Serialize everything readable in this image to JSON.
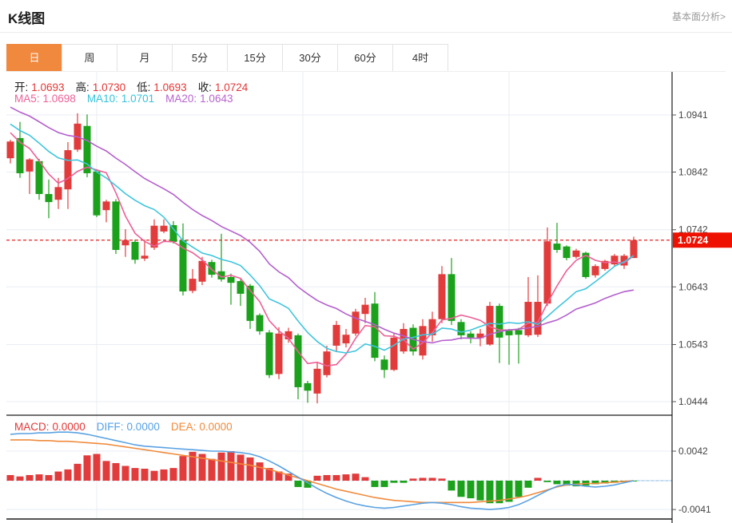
{
  "header": {
    "title": "K线图",
    "link": "基本面分析>"
  },
  "tabs": {
    "items": [
      "日",
      "周",
      "月",
      "5分",
      "15分",
      "30分",
      "60分",
      "4时"
    ],
    "active_index": 0
  },
  "ohlc": {
    "open_label": "开:",
    "open": "1.0693",
    "high_label": "高:",
    "high": "1.0730",
    "low_label": "低:",
    "low": "1.0693",
    "close_label": "收:",
    "close": "1.0724"
  },
  "ma_legend": {
    "ma5_label": "MA5:",
    "ma5": "1.0698",
    "ma10_label": "MA10:",
    "ma10": "1.0701",
    "ma20_label": "MA20:",
    "ma20": "1.0643"
  },
  "macd_legend": {
    "macd_label": "MACD:",
    "macd": "0.0000",
    "diff_label": "DIFF:",
    "diff": "0.0000",
    "dea_label": "DEA:",
    "dea": "0.0000"
  },
  "colors": {
    "up": "#e23b3b",
    "down": "#1ba11b",
    "ma5": "#ed5f96",
    "ma10": "#3fc5dd",
    "ma20": "#b45fcd",
    "diff": "#5aa2e2",
    "dea": "#f08a3c",
    "badge": "#ee1100",
    "price_line": "#e62222",
    "grid": "#e8edf4",
    "vgrid": "#e9ecf1",
    "zero_line": "#b9d2e8",
    "axis": "#1a1a1a",
    "axis_text": "#444444",
    "tab_active": "#f0883e"
  },
  "chart_data": {
    "type": "candlestick+macd",
    "title": "K线图",
    "legend_position": "top-left",
    "grid": true,
    "price_axis": {
      "ticks": [
        "1.0941",
        "1.0842",
        "1.0742",
        "1.0643",
        "1.0543",
        "1.0444"
      ],
      "current": "1.0724",
      "range": [
        1.043,
        1.1015
      ]
    },
    "macd_axis": {
      "ticks": [
        "0.0042",
        "-0.0041"
      ],
      "zero": 0.0
    },
    "candle_format": "[open, high, low, close]",
    "prehistory_closes": [
      1.101,
      1.1004,
      1.0998,
      1.0993,
      1.0987,
      1.0981,
      1.0975,
      1.0969,
      1.0963,
      1.0958,
      1.0952,
      1.0946,
      1.094,
      1.0934,
      1.0929,
      1.0923,
      1.0917,
      1.0911,
      1.0905
    ],
    "candles": [
      [
        1.0866,
        1.0898,
        1.0857,
        1.0895
      ],
      [
        1.0901,
        1.0929,
        1.0832,
        1.084
      ],
      [
        1.0843,
        1.0866,
        1.0804,
        1.0864
      ],
      [
        1.0861,
        1.0865,
        1.0794,
        1.0804
      ],
      [
        1.0804,
        1.0829,
        1.0762,
        1.079
      ],
      [
        1.0794,
        1.0832,
        1.0778,
        1.0816
      ],
      [
        1.0812,
        1.0894,
        1.0778,
        1.088
      ],
      [
        1.0881,
        1.0944,
        1.0877,
        1.0926
      ],
      [
        1.0922,
        1.0942,
        1.0833,
        1.084
      ],
      [
        1.0843,
        1.0845,
        1.0764,
        1.0767
      ],
      [
        1.0776,
        1.0794,
        1.0755,
        1.0791
      ],
      [
        1.0791,
        1.0795,
        1.07,
        1.0707
      ],
      [
        1.0715,
        1.0743,
        1.0695,
        1.0724
      ],
      [
        1.0721,
        1.0725,
        1.0683,
        1.069
      ],
      [
        1.0692,
        1.0725,
        1.0688,
        1.0697
      ],
      [
        1.0711,
        1.076,
        1.0707,
        1.0749
      ],
      [
        1.0739,
        1.076,
        1.0736,
        1.0749
      ],
      [
        1.075,
        1.0757,
        1.0718,
        1.0721
      ],
      [
        1.0724,
        1.0753,
        1.0628,
        1.0635
      ],
      [
        1.0636,
        1.0674,
        1.0632,
        1.0657
      ],
      [
        1.0652,
        1.0695,
        1.0646,
        1.0688
      ],
      [
        1.0686,
        1.069,
        1.0659,
        1.0664
      ],
      [
        1.067,
        1.0735,
        1.0652,
        1.0656
      ],
      [
        1.066,
        1.0666,
        1.0612,
        1.065
      ],
      [
        1.0653,
        1.0656,
        1.061,
        1.0631
      ],
      [
        1.0645,
        1.0648,
        1.057,
        1.0584
      ],
      [
        1.0594,
        1.0597,
        1.056,
        1.0566
      ],
      [
        1.0564,
        1.0568,
        1.0485,
        1.049
      ],
      [
        1.0492,
        1.0573,
        1.0483,
        1.0562
      ],
      [
        1.0552,
        1.0572,
        1.0546,
        1.0566
      ],
      [
        1.0559,
        1.0562,
        1.0448,
        1.0469
      ],
      [
        1.0476,
        1.048,
        1.0442,
        1.0463
      ],
      [
        1.0458,
        1.0512,
        1.0441,
        1.0501
      ],
      [
        1.049,
        1.0541,
        1.0486,
        1.0531
      ],
      [
        1.0541,
        1.0584,
        1.0531,
        1.0577
      ],
      [
        1.0545,
        1.057,
        1.0538,
        1.056
      ],
      [
        1.0562,
        1.0605,
        1.0558,
        1.06
      ],
      [
        1.0596,
        1.0624,
        1.058,
        1.0612
      ],
      [
        1.0614,
        1.0634,
        1.0514,
        1.052
      ],
      [
        1.0517,
        1.0524,
        1.0485,
        1.0499
      ],
      [
        1.0499,
        1.0562,
        1.0497,
        1.0555
      ],
      [
        1.0531,
        1.058,
        1.0527,
        1.057
      ],
      [
        1.0572,
        1.0578,
        1.0524,
        1.0531
      ],
      [
        1.0524,
        1.0587,
        1.0517,
        1.0575
      ],
      [
        1.0559,
        1.06,
        1.0548,
        1.0587
      ],
      [
        1.0587,
        1.0679,
        1.058,
        1.0665
      ],
      [
        1.0665,
        1.0693,
        1.0577,
        1.0584
      ],
      [
        1.0582,
        1.0587,
        1.0552,
        1.0559
      ],
      [
        1.0562,
        1.0566,
        1.0545,
        1.0555
      ],
      [
        1.0554,
        1.057,
        1.054,
        1.0562
      ],
      [
        1.0543,
        1.0617,
        1.0541,
        1.061
      ],
      [
        1.061,
        1.0614,
        1.0511,
        1.0555
      ],
      [
        1.0567,
        1.057,
        1.0508,
        1.0559
      ],
      [
        1.0568,
        1.0572,
        1.051,
        1.056
      ],
      [
        1.0559,
        1.066,
        1.0556,
        1.0617
      ],
      [
        1.056,
        1.0663,
        1.0556,
        1.0617
      ],
      [
        1.0614,
        1.0746,
        1.061,
        1.0722
      ],
      [
        1.0718,
        1.0754,
        1.0702,
        1.0707
      ],
      [
        1.0713,
        1.0715,
        1.0689,
        1.0693
      ],
      [
        1.0695,
        1.0709,
        1.0692,
        1.0706
      ],
      [
        1.0702,
        1.0704,
        1.0657,
        1.066
      ],
      [
        1.0663,
        1.0682,
        1.0659,
        1.0679
      ],
      [
        1.0674,
        1.069,
        1.0671,
        1.0688
      ],
      [
        1.0682,
        1.07,
        1.0678,
        1.0697
      ],
      [
        1.068,
        1.07,
        1.0674,
        1.0697
      ],
      [
        1.0693,
        1.073,
        1.0693,
        1.0724
      ]
    ],
    "ma_periods": [
      5,
      10,
      20
    ],
    "macd": {
      "hist": [
        0.0008,
        0.0006,
        0.0008,
        0.0009,
        0.0008,
        0.0013,
        0.0016,
        0.0024,
        0.0036,
        0.0038,
        0.0028,
        0.0025,
        0.0021,
        0.0018,
        0.0017,
        0.0014,
        0.0016,
        0.0018,
        0.0035,
        0.0041,
        0.0038,
        0.0031,
        0.004,
        0.0042,
        0.0037,
        0.0033,
        0.0026,
        0.0018,
        0.0013,
        0.001,
        -0.0009,
        -0.001,
        0.0007,
        0.0008,
        0.0008,
        0.0009,
        0.001,
        0.0005,
        -0.0009,
        -0.0009,
        -0.0003,
        -0.0003,
        0.0003,
        0.0004,
        0.0004,
        0.0003,
        -0.0014,
        -0.0023,
        -0.0025,
        -0.0028,
        -0.0032,
        -0.0032,
        -0.003,
        -0.0023,
        -0.001,
        0.0004,
        -0.0002,
        -0.0005,
        -0.0007,
        -0.0008,
        -0.0007,
        -0.0005,
        -0.0004,
        -0.0003,
        -0.0002,
        -0.0001
      ],
      "diff": [
        0.0066,
        0.0067,
        0.0067,
        0.0068,
        0.0068,
        0.0069,
        0.0069,
        0.0068,
        0.0066,
        0.0063,
        0.006,
        0.0057,
        0.0054,
        0.0051,
        0.0049,
        0.0048,
        0.0047,
        0.0046,
        0.0045,
        0.0044,
        0.0043,
        0.0042,
        0.0042,
        0.0041,
        0.004,
        0.0038,
        0.0034,
        0.0028,
        0.0021,
        0.0013,
        0.0005,
        -0.0003,
        -0.0011,
        -0.0018,
        -0.0024,
        -0.0029,
        -0.0033,
        -0.0036,
        -0.0038,
        -0.0039,
        -0.0038,
        -0.0036,
        -0.0034,
        -0.0032,
        -0.0031,
        -0.0032,
        -0.0034,
        -0.0037,
        -0.0039,
        -0.004,
        -0.0041,
        -0.004,
        -0.0038,
        -0.0034,
        -0.0028,
        -0.0021,
        -0.0014,
        -0.0008,
        -0.0005,
        -0.0006,
        -0.0008,
        -0.0009,
        -0.0008,
        -0.0006,
        -0.0003,
        0.0
      ],
      "dea": [
        0.0058,
        0.0058,
        0.0058,
        0.0057,
        0.0057,
        0.0056,
        0.0056,
        0.0055,
        0.0054,
        0.0053,
        0.0052,
        0.005,
        0.0048,
        0.0046,
        0.0044,
        0.0042,
        0.004,
        0.0038,
        0.0036,
        0.0034,
        0.0032,
        0.003,
        0.0028,
        0.0026,
        0.0024,
        0.0022,
        0.0019,
        0.0016,
        0.0012,
        0.0008,
        0.0004,
        0.0,
        -0.0004,
        -0.0008,
        -0.0012,
        -0.0015,
        -0.0018,
        -0.0021,
        -0.0024,
        -0.0026,
        -0.0028,
        -0.0029,
        -0.003,
        -0.0031,
        -0.0031,
        -0.0031,
        -0.0031,
        -0.0031,
        -0.0031,
        -0.003,
        -0.0029,
        -0.0028,
        -0.0026,
        -0.0024,
        -0.0021,
        -0.0017,
        -0.0013,
        -0.0009,
        -0.0006,
        -0.0005,
        -0.0004,
        -0.0004,
        -0.0003,
        -0.0002,
        -0.0001,
        0.0
      ]
    }
  }
}
